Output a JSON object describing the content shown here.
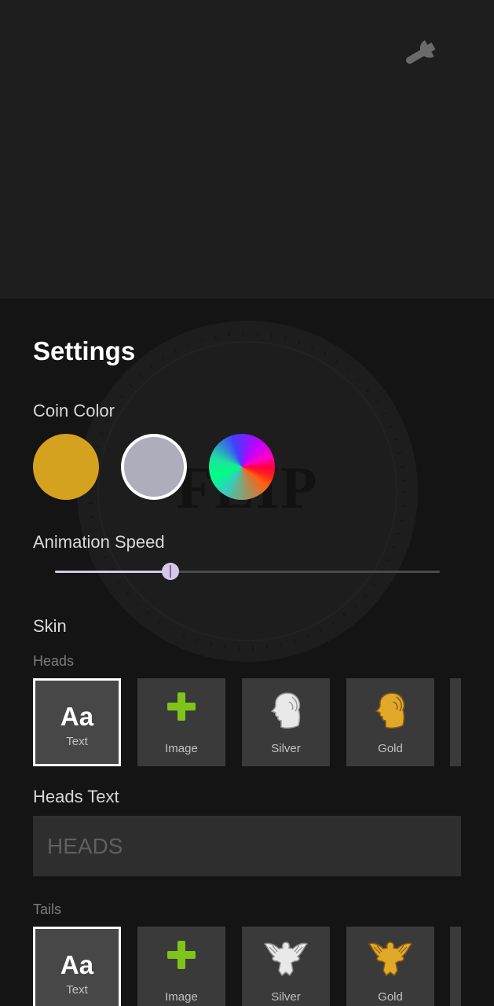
{
  "top": {
    "settings_icon": "wrench-icon"
  },
  "background_coin": {
    "text": "FLIP"
  },
  "settings": {
    "title": "Settings",
    "coin_color": {
      "label": "Coin Color",
      "options": [
        {
          "name": "gold",
          "color": "#d4a21e"
        },
        {
          "name": "silver",
          "color": "#aeadbb",
          "selected": true
        },
        {
          "name": "rainbow",
          "color": "gradient"
        }
      ]
    },
    "animation_speed": {
      "label": "Animation Speed",
      "value": 0.3
    },
    "skin": {
      "label": "Skin",
      "heads": {
        "label": "Heads",
        "tiles": [
          {
            "label": "Text",
            "glyph": "Aa",
            "selected": true
          },
          {
            "label": "Image",
            "icon": "plus-icon"
          },
          {
            "label": "Silver",
            "icon": "silver-portrait-icon"
          },
          {
            "label": "Gold",
            "icon": "gold-portrait-icon"
          }
        ],
        "text_label": "Heads Text",
        "text_placeholder": "HEADS"
      },
      "tails": {
        "label": "Tails",
        "tiles": [
          {
            "label": "Text",
            "glyph": "Aa",
            "selected": true
          },
          {
            "label": "Image",
            "icon": "plus-icon"
          },
          {
            "label": "Silver",
            "icon": "silver-eagle-icon"
          },
          {
            "label": "Gold",
            "icon": "gold-eagle-icon"
          }
        ]
      }
    }
  }
}
